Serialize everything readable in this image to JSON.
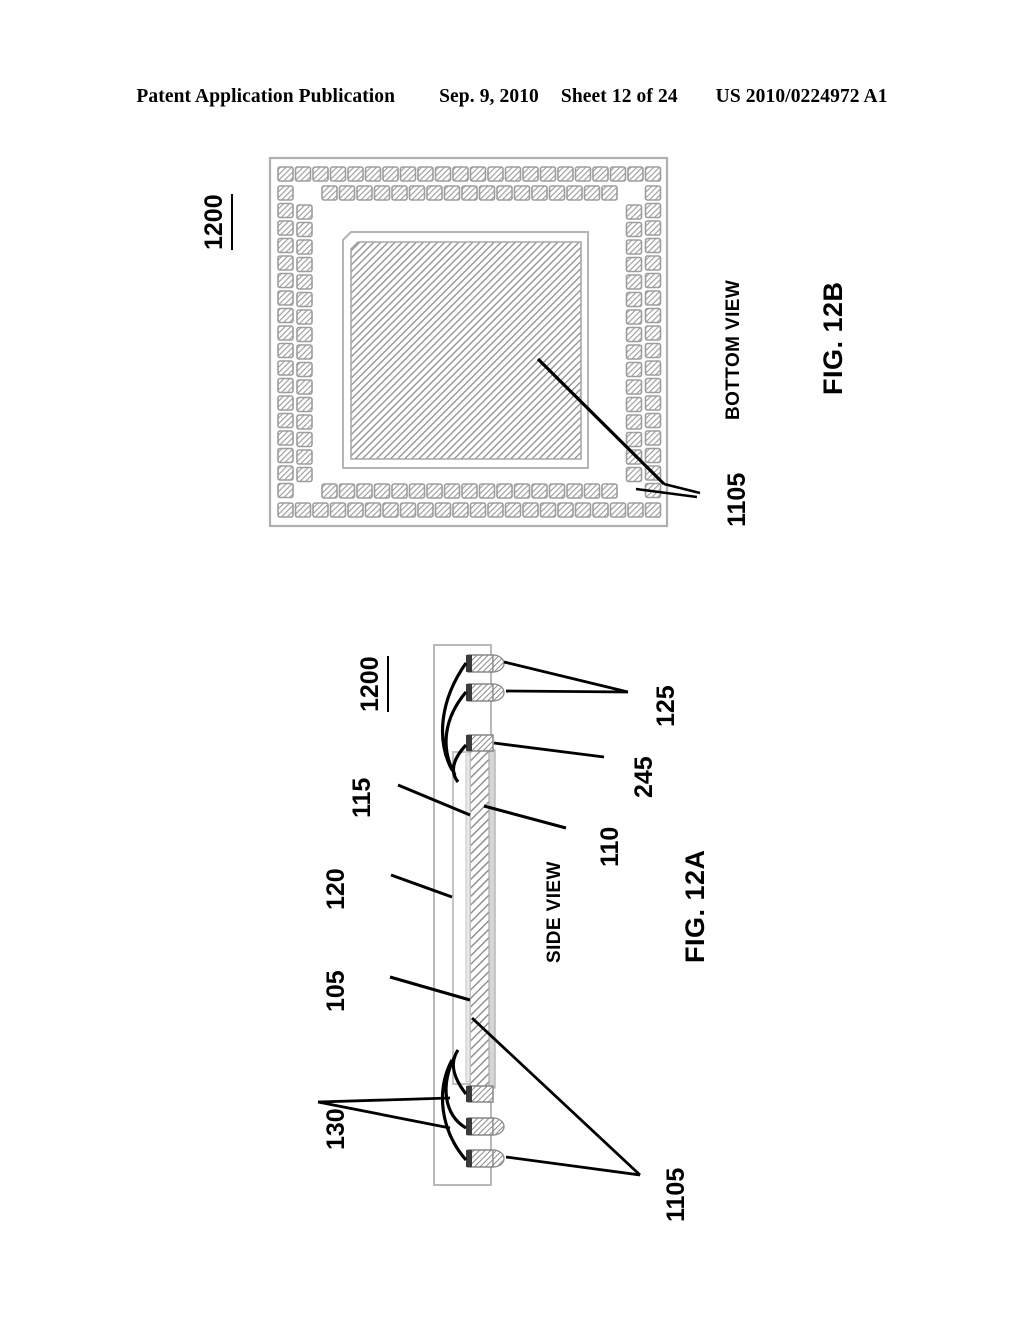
{
  "header": {
    "publication": "Patent Application Publication",
    "date": "Sep. 9, 2010",
    "sheet": "Sheet 12 of 24",
    "patent_number": "US 2010/0224972 A1"
  },
  "figures": [
    {
      "id": "fig-12b",
      "label": "FIG. 12B",
      "view": "BOTTOM VIEW",
      "assembly_ref": "1200",
      "callouts": [
        {
          "ref": "1105",
          "name": "solder-pad"
        }
      ]
    },
    {
      "id": "fig-12a",
      "label": "FIG. 12A",
      "view": "SIDE VIEW",
      "assembly_ref": "1200",
      "callouts": [
        {
          "ref": "105",
          "name": "mold-compound"
        },
        {
          "ref": "110",
          "name": "substrate"
        },
        {
          "ref": "115",
          "name": "die"
        },
        {
          "ref": "120",
          "name": "encapsulant"
        },
        {
          "ref": "125",
          "name": "solder-ball"
        },
        {
          "ref": "130",
          "name": "bond-wire"
        },
        {
          "ref": "245",
          "name": "contact-pad"
        },
        {
          "ref": "1105",
          "name": "solder-pad"
        }
      ]
    }
  ],
  "colors": {
    "ink": "#000000",
    "hatch": "#9a9a9a",
    "pad_fill": "#c9c9c9",
    "outline_light": "#b4b4b4",
    "page_bg": "#ffffff"
  }
}
